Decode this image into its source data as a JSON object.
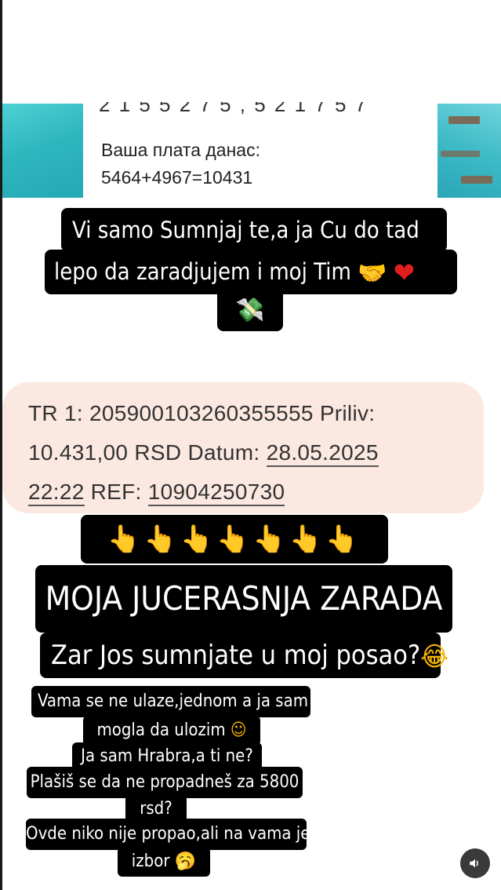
{
  "top_sms": {
    "cut_digits": "2 1 5 5 2 7 5 , 5 2 1 7 5 7",
    "line1": "Ваша плата данас:",
    "line2": "5464+4967=10431"
  },
  "caption_a": {
    "line1": "Vi samo Sumnjaj te,a ja Cu do tad",
    "line2": "lepo da zaradjujem i moj Tim",
    "emoji_handshake": "handshake-icon",
    "emoji_heart": "heart-icon",
    "emoji_money": "money-wings-icon"
  },
  "bank_sms": {
    "line1": "TR 1: 205900103260355555 Priliv:",
    "line2_prefix": "10.431,00 RSD Datum: ",
    "date": "28.05.2025",
    "time": "22:22",
    "ref_label": " REF: ",
    "ref": "10904250730"
  },
  "caption_b": {
    "pointers": "👆👆👆👆👆👆👆",
    "pointer_icon": "pointing-up-icon",
    "headline": "MOJA JUCERASNJA ZARADA",
    "question": "Zar Jos sumnjate u moj posao?",
    "emoji_laugh": "laughing-tears-icon"
  },
  "caption_c": {
    "line1": "Vama se ne ulaze,jednom a ja sam",
    "line2": "mogla da ulozim",
    "line3": "Ja sam Hrabra,a ti ne?",
    "line4": "Plašiš se da ne propadneš za 5800",
    "line5": "rsd?",
    "line6": "Ovde niko nije propao,ali na vama je",
    "line7": "izbor",
    "emoji_smile": "blushing-smile-icon",
    "emoji_yawn": "yawning-face-icon"
  },
  "controls": {
    "sound_icon": "speaker-icon"
  },
  "colors": {
    "caption_bg": "#000000",
    "bubble_bg": "#fbe8e1",
    "emoji_yellow": "#f5b400",
    "heart_red": "#e0201f"
  }
}
